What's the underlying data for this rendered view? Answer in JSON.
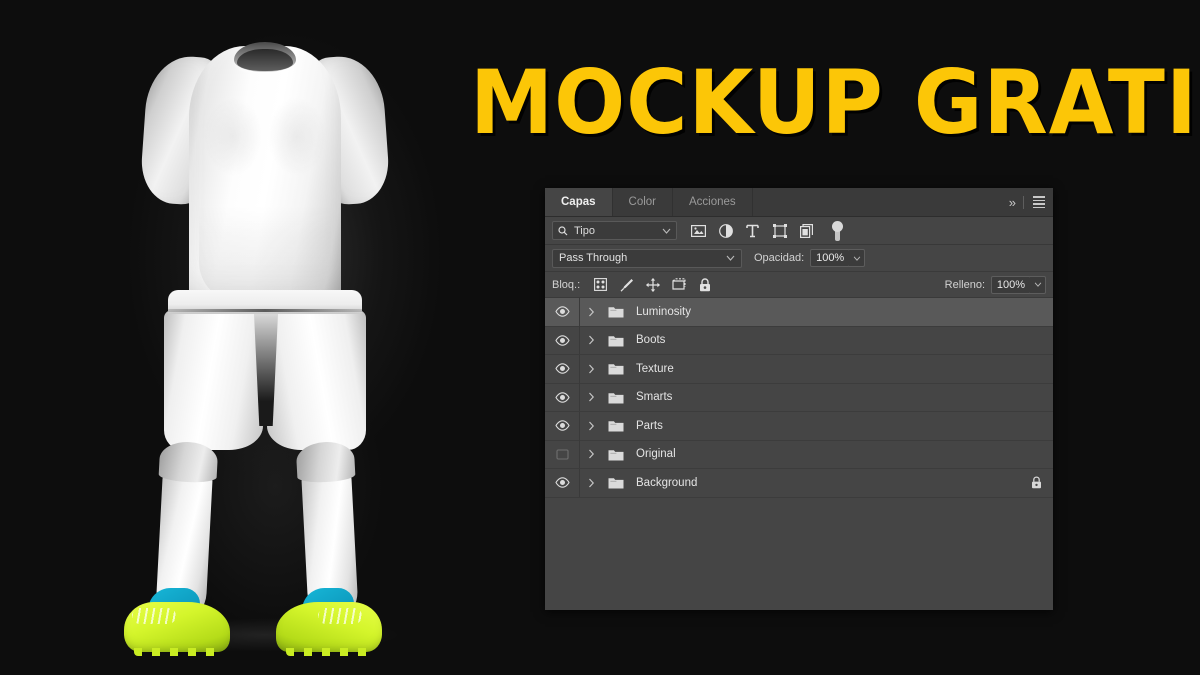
{
  "hero": {
    "title": "MOCKUP GRATIS",
    "title_color": "#fcc607",
    "background_color": "#0d0d0d",
    "mockup_name": "soccer-kit-mockup",
    "mockup_items": [
      "jersey",
      "shorts",
      "socks",
      "boots"
    ],
    "boot_color": "#d4f52b",
    "boot_accent_color": "#0f9fc2"
  },
  "panel": {
    "tabs": [
      {
        "label": "Capas",
        "active": true
      },
      {
        "label": "Color",
        "active": false
      },
      {
        "label": "Acciones",
        "active": false
      }
    ],
    "collapse_icon": "»",
    "menu_icon": "hamburger-icon",
    "filter": {
      "search_icon": "search-icon",
      "type_label": "Tipo",
      "chevron": "⌄",
      "icons": [
        "pixel-layer-filter-icon",
        "adjustment-layer-filter-icon",
        "type-layer-filter-icon",
        "shape-layer-filter-icon",
        "smart-object-filter-icon"
      ],
      "toggle_name": "filter-enable-toggle"
    },
    "blend": {
      "mode": "Pass Through",
      "chevron": "⌄",
      "opacity_label": "Opacidad:",
      "opacity_value": "100%",
      "fill_label": "Relleno:",
      "fill_value": "100%"
    },
    "lock": {
      "label": "Bloq.:",
      "icons": [
        "lock-transparency-icon",
        "lock-image-icon",
        "lock-position-icon",
        "lock-artboard-icon",
        "lock-all-icon"
      ]
    },
    "layers": [
      {
        "name": "Luminosity",
        "visible": true,
        "selected": true,
        "locked": false,
        "type": "group"
      },
      {
        "name": "Boots",
        "visible": true,
        "selected": false,
        "locked": false,
        "type": "group"
      },
      {
        "name": "Texture",
        "visible": true,
        "selected": false,
        "locked": false,
        "type": "group"
      },
      {
        "name": "Smarts",
        "visible": true,
        "selected": false,
        "locked": false,
        "type": "group"
      },
      {
        "name": "Parts",
        "visible": true,
        "selected": false,
        "locked": false,
        "type": "group"
      },
      {
        "name": "Original",
        "visible": false,
        "selected": false,
        "locked": false,
        "type": "group"
      },
      {
        "name": "Background",
        "visible": true,
        "selected": false,
        "locked": true,
        "type": "group"
      }
    ]
  }
}
